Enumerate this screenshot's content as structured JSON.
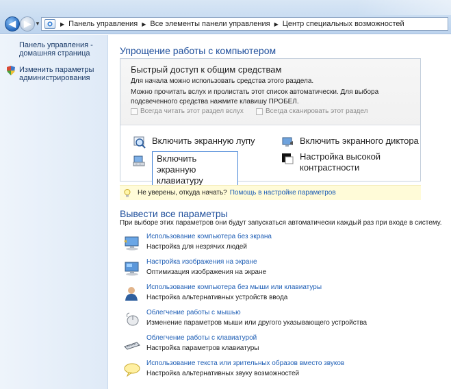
{
  "breadcrumb": {
    "items": [
      "Панель управления",
      "Все элементы панели управления",
      "Центр специальных возможностей"
    ]
  },
  "left_pane": {
    "home_link": "Панель управления - домашняя страница",
    "admin_link": "Изменить параметры администрирования"
  },
  "main": {
    "title": "Упрощение работы с компьютером",
    "quick_access": {
      "title": "Быстрый доступ к общим средствам",
      "text1": "Для начала можно использовать средства этого раздела.",
      "text2": "Можно прочитать вслух и пролистать этот список автоматически. Для выбора подсвеченного средства нажмите клавишу ПРОБЕЛ.",
      "checkbox_read": "Всегда читать этот раздел вслух",
      "checkbox_scan": "Всегда сканировать этот раздел"
    },
    "options": {
      "magnifier": "Включить экранную лупу",
      "narrator": "Включить экранного диктора",
      "keyboard": "Включить экранную клавиатуру",
      "contrast": "Настройка высокой контрастности"
    },
    "tip": {
      "question": "Не уверены, откуда начать?",
      "link": "Помощь в настройке параметров"
    },
    "all_settings": {
      "title": "Вывести все параметры",
      "desc": "При выборе этих параметров они будут запускаться автоматически каждый раз при входе в систему.",
      "items": [
        {
          "link": "Использование компьютера без экрана",
          "desc": "Настройка для незрячих людей"
        },
        {
          "link": "Настройка изображения на экране",
          "desc": "Оптимизация изображения на экране"
        },
        {
          "link": "Использование компьютера без мыши или клавиатуры",
          "desc": "Настройка альтернативных устройств ввода"
        },
        {
          "link": "Облегчение работы с мышью",
          "desc": "Изменение параметров мыши или другого указывающего устройства"
        },
        {
          "link": "Облегчение работы с клавиатурой",
          "desc": "Настройка параметров клавиатуры"
        },
        {
          "link": "Использование текста или зрительных образов вместо звуков",
          "desc": "Настройка альтернативных звуку возможностей"
        }
      ]
    }
  },
  "colors": {
    "link": "#1e5eb5",
    "heading": "#1e4e9b",
    "tip_bg": "#fffbd8"
  }
}
